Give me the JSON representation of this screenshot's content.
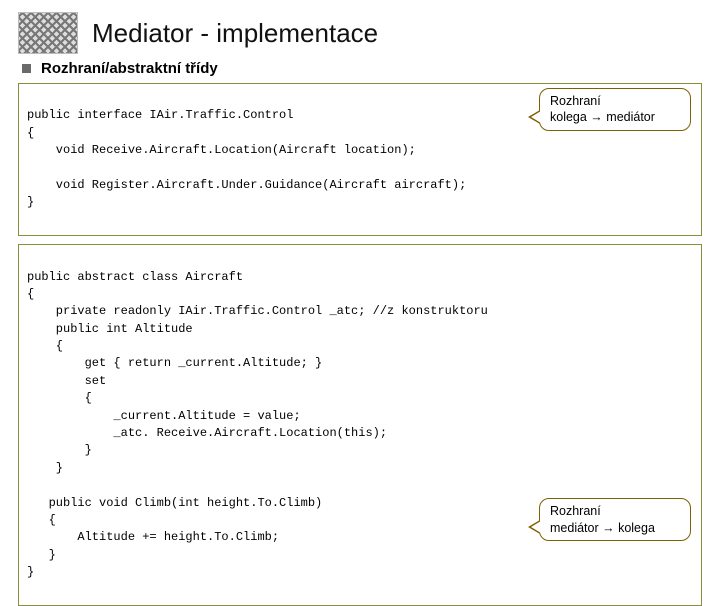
{
  "header": {
    "title": "Mediator - implementace"
  },
  "subtitle": "Rozhraní/abstraktní třídy",
  "code1": {
    "l1": "public interface IAir.Traffic.Control",
    "l2": "{",
    "l3": "    void Receive.Aircraft.Location(Aircraft location);",
    "l4": "",
    "l5": "    void Register.Aircraft.Under.Guidance(Aircraft aircraft);",
    "l6": "}"
  },
  "callout1": {
    "line1": "Rozhraní",
    "line2": "kolega → mediátor"
  },
  "code2": {
    "l1": "public abstract class Aircraft",
    "l2": "{",
    "l3": "    private readonly IAir.Traffic.Control _atc; //z konstruktoru",
    "l4": "    public int Altitude",
    "l5": "    {",
    "l6": "        get { return _current.Altitude; }",
    "l7": "        set",
    "l8": "        {",
    "l9": "            _current.Altitude = value;",
    "l10": "            _atc. Receive.Aircraft.Location(this);",
    "l11": "        }",
    "l12": "    }",
    "l13": "",
    "l14": "   public void Climb(int height.To.Climb)",
    "l15": "   {",
    "l16": "       Altitude += height.To.Climb;",
    "l17": "   }",
    "l18": "}"
  },
  "callout2": {
    "line1": "Rozhraní",
    "line2": "mediátor → kolega"
  }
}
